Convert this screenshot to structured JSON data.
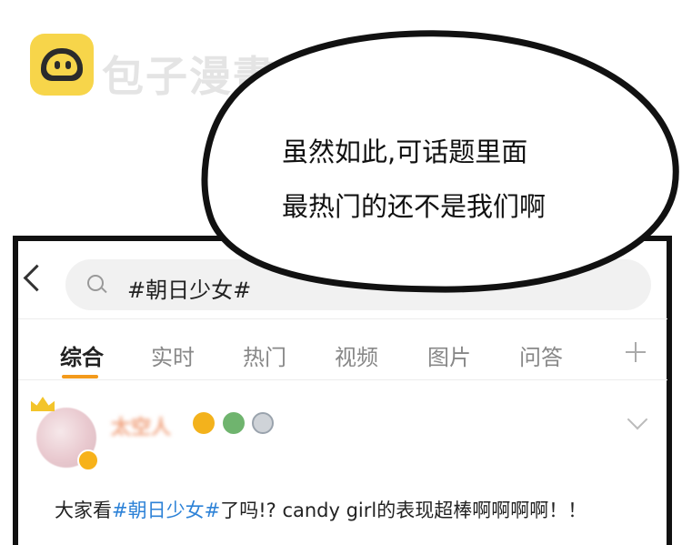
{
  "watermark": {
    "name": "包子漫畫"
  },
  "search": {
    "query": "#朝日少女#"
  },
  "tabs": [
    "综合",
    "实时",
    "热门",
    "视频",
    "图片",
    "问答"
  ],
  "post": {
    "username": "太空人",
    "text_before": "大家看",
    "hashtag": "#朝日少女#",
    "text_after": "了吗!? candy girl的表现超棒啊啊啊啊！！"
  },
  "speech_bubble": {
    "line1": "虽然如此,可话题里面",
    "line2": "最热门的还不是我们啊"
  },
  "colors": {
    "accent": "#f39a1b",
    "hashtag": "#2d82d7",
    "logo": "#f7d54a"
  },
  "icons": [
    "back-arrow-icon",
    "search-icon",
    "plus-icon",
    "crown-icon",
    "verified-icon",
    "chevron-down-icon"
  ]
}
